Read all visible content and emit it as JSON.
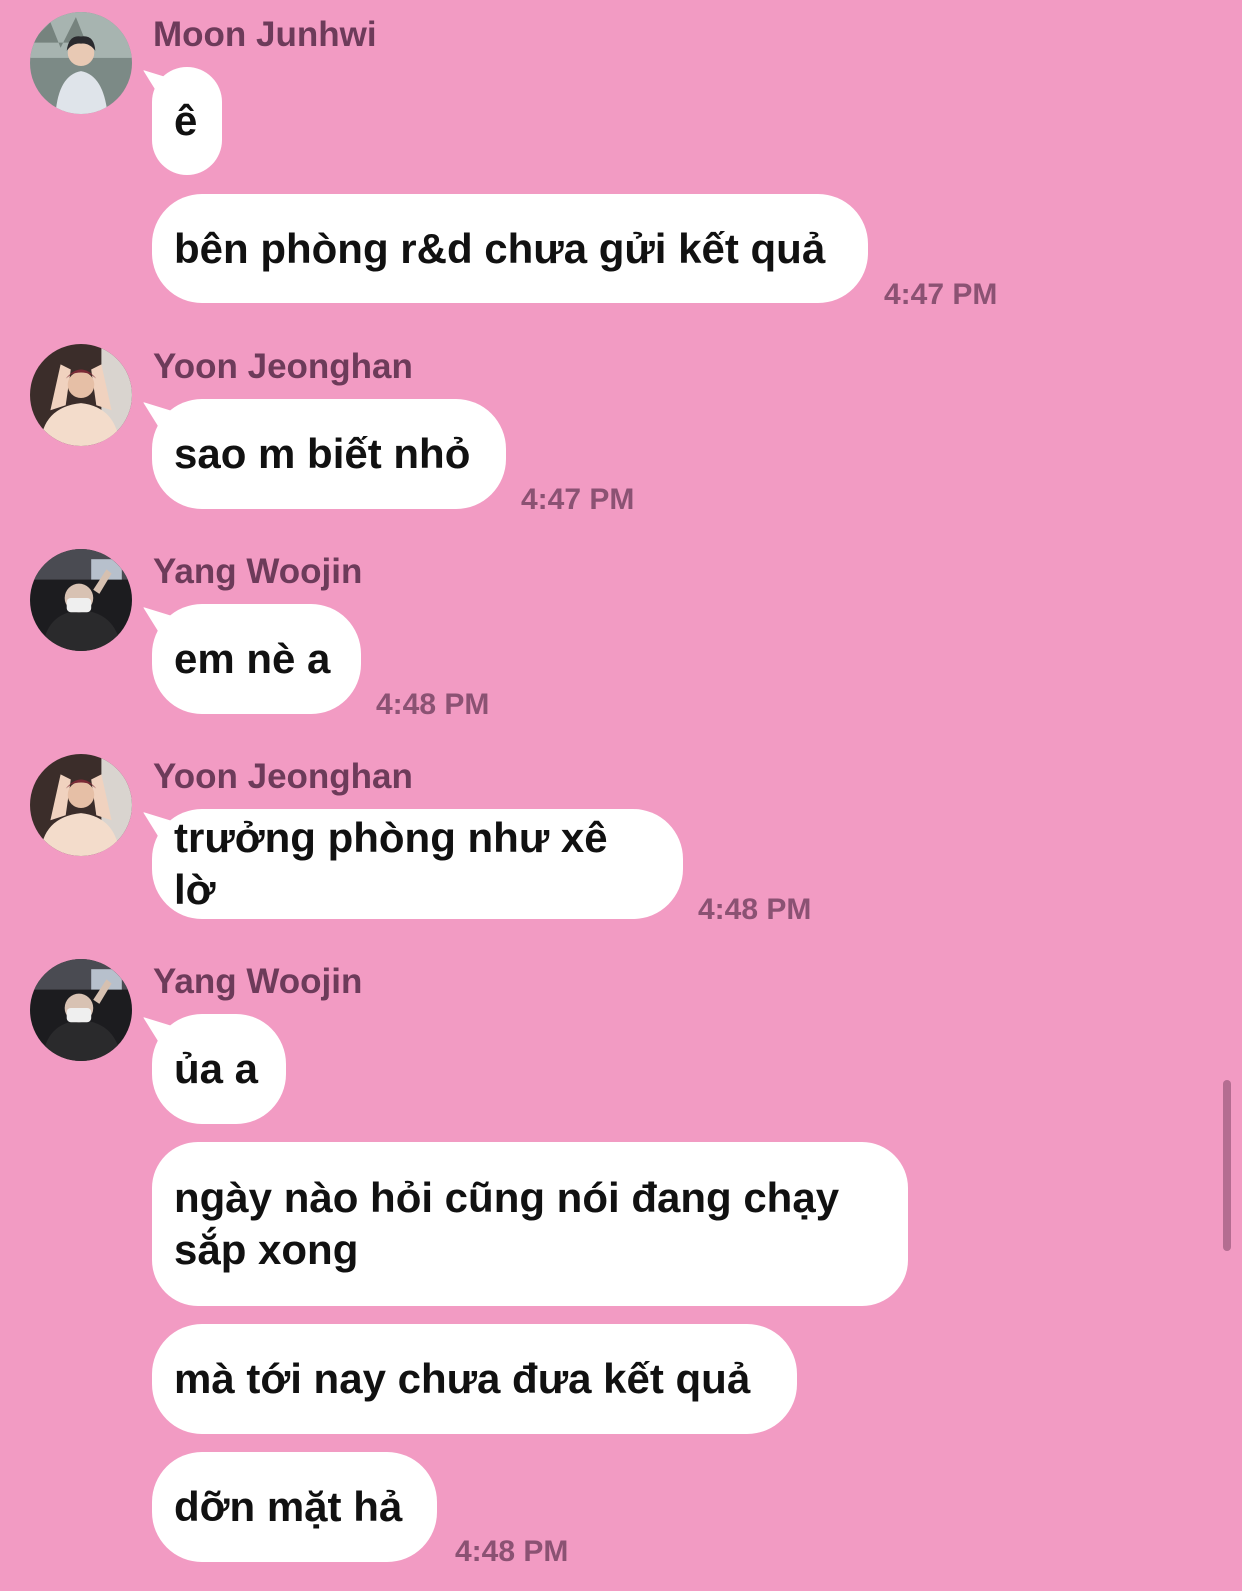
{
  "colors": {
    "background": "#f29bc3",
    "bubble": "#ffffff",
    "sender_name": "#6d3b5a",
    "timestamp": "#8b5273"
  },
  "messages": [
    {
      "sender": "Moon Junhwi",
      "avatar": "avatar-moon-junhwi",
      "texts": [
        "ê",
        "bên phòng r&d chưa gửi kết quả"
      ],
      "time": "4:47 PM"
    },
    {
      "sender": "Yoon Jeonghan",
      "avatar": "avatar-yoon-jeonghan",
      "texts": [
        "sao m biết nhỏ"
      ],
      "time": "4:47 PM"
    },
    {
      "sender": "Yang Woojin",
      "avatar": "avatar-yang-woojin",
      "texts": [
        "em nè a"
      ],
      "time": "4:48 PM"
    },
    {
      "sender": "Yoon Jeonghan",
      "avatar": "avatar-yoon-jeonghan",
      "texts": [
        "trưởng phòng như xê lờ"
      ],
      "time": "4:48 PM"
    },
    {
      "sender": "Yang Woojin",
      "avatar": "avatar-yang-woojin",
      "texts": [
        "ủa a",
        "ngày nào hỏi cũng nói đang chạy sắp xong",
        "mà tới nay chưa đưa kết quả",
        "dỡn mặt hả"
      ],
      "time": "4:48 PM"
    }
  ]
}
